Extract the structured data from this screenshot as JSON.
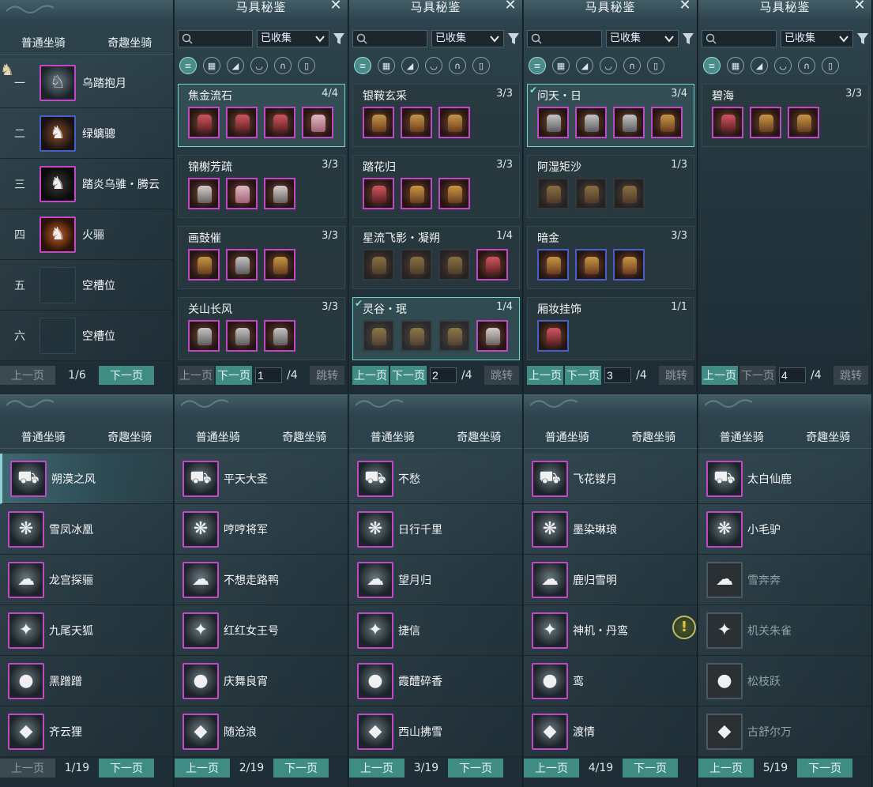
{
  "top_left": {
    "tabs": [
      "普通坐骑",
      "奇趣坐骑"
    ],
    "rows": [
      {
        "rank": "一",
        "name": "乌踏抱月",
        "icon": "white-horse"
      },
      {
        "rank": "二",
        "name": "绿螭骢",
        "icon": "brown-horse"
      },
      {
        "rank": "三",
        "name": "踏炎乌骓・腾云",
        "icon": "black-horse"
      },
      {
        "rank": "四",
        "name": "火骊",
        "icon": "red-horse"
      },
      {
        "rank": "五",
        "name": "空槽位",
        "icon": "empty-slot"
      },
      {
        "rank": "六",
        "name": "空槽位",
        "icon": "empty-slot"
      }
    ],
    "pager": {
      "prev": "上一页",
      "page": "1/6",
      "next": "下一页"
    }
  },
  "codex": {
    "title": "马具秘鉴",
    "search_placeholder": "",
    "filter_value": "已收集",
    "icons": [
      "list-icon",
      "grid-icon",
      "saddle-icon",
      "wing-icon",
      "horseshoe-icon",
      "armor-icon"
    ],
    "prev": "上一页",
    "next": "下一页",
    "jump": "跳转",
    "panels": [
      {
        "page": "1",
        "total": "/4",
        "sets": [
          {
            "name": "焦金流石",
            "count": "4/4"
          },
          {
            "name": "锦榭芳疏",
            "count": "3/3"
          },
          {
            "name": "画鼓催",
            "count": "3/3"
          },
          {
            "name": "关山长风",
            "count": "3/3"
          }
        ]
      },
      {
        "page": "2",
        "total": "/4",
        "sets": [
          {
            "name": "银鞍玄采",
            "count": "3/3"
          },
          {
            "name": "踏花归",
            "count": "3/3"
          },
          {
            "name": "星流飞影・凝朔",
            "count": "1/4"
          },
          {
            "name": "灵谷・珉",
            "count": "1/4"
          }
        ]
      },
      {
        "page": "3",
        "total": "/4",
        "sets": [
          {
            "name": "问天・日",
            "count": "3/4"
          },
          {
            "name": "阿湿矩沙",
            "count": "1/3"
          },
          {
            "name": "暗金",
            "count": "3/3"
          },
          {
            "name": "厢妆挂饰",
            "count": "1/1"
          }
        ]
      },
      {
        "page": "4",
        "total": "/4",
        "sets": [
          {
            "name": "碧海",
            "count": "3/3"
          }
        ]
      }
    ]
  },
  "fun": {
    "tabs": [
      "普通坐骑",
      "奇趣坐骑"
    ],
    "prev": "上一页",
    "next": "下一页",
    "panels": [
      {
        "page": "1/19",
        "items": [
          "朔漠之风",
          "雪凤冰凰",
          "龙宫探骊",
          "九尾天狐",
          "黑蹭蹭",
          "齐云狸"
        ]
      },
      {
        "page": "2/19",
        "items": [
          "平天大圣",
          "哼哼将军",
          "不想走路鸭",
          "红红女王号",
          "庆舞良宵",
          "随沧浪"
        ]
      },
      {
        "page": "3/19",
        "items": [
          "不愁",
          "日行千里",
          "望月归",
          "捷信",
          "霞醴碎香",
          "西山拂雪"
        ]
      },
      {
        "page": "4/19",
        "items": [
          "飞花镂月",
          "墨染琳琅",
          "鹿归雪明",
          "神机・丹鸾",
          "鸾",
          "渡情"
        ]
      },
      {
        "page": "5/19",
        "items": [
          "太白仙鹿",
          "小毛驴",
          "雪奔奔",
          "机关朱雀",
          "松枝跃",
          "古舒尔万"
        ]
      }
    ]
  },
  "colors": {
    "accent": "#3e8c84",
    "rarity_purple": "#c048c6",
    "rarity_blue": "#4660c8",
    "complete_border": "#6fd3cf"
  }
}
